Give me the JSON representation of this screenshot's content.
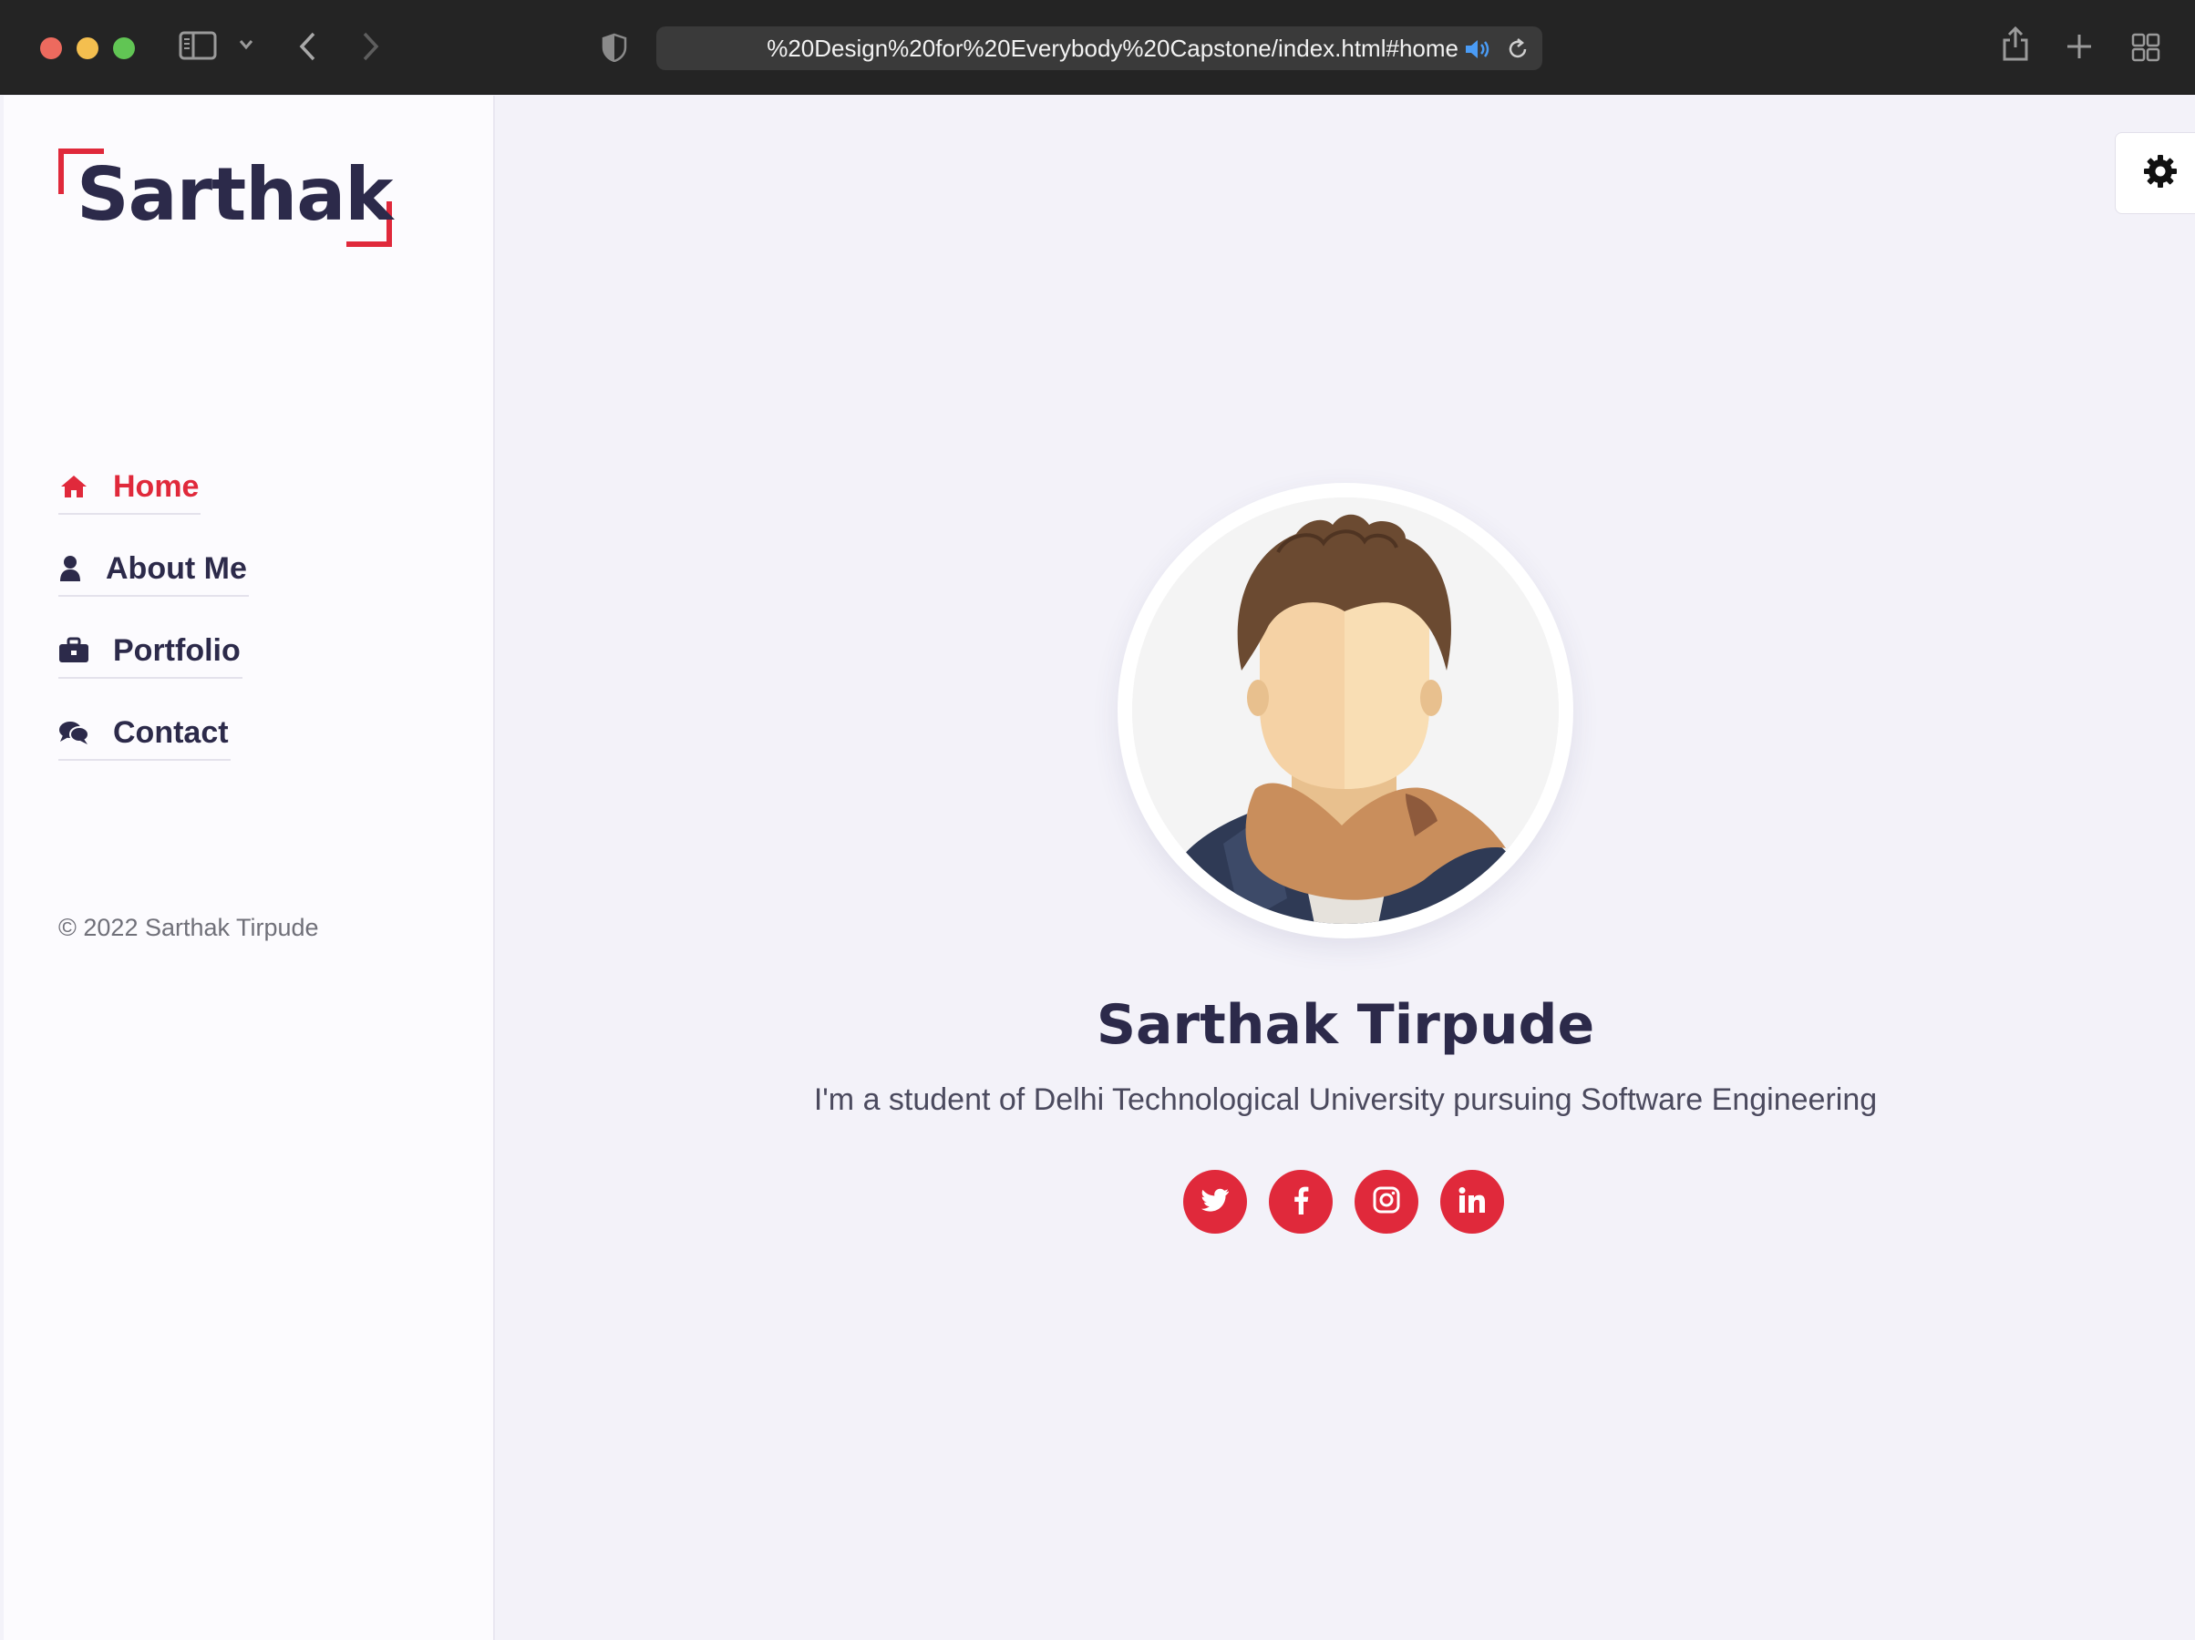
{
  "browser": {
    "url": "%20Design%20for%20Everybody%20Capstone/index.html#home",
    "icons": [
      "sidebar-toggle-icon",
      "chevron-down-icon",
      "back-icon",
      "forward-icon",
      "shield-icon",
      "speaker-icon",
      "reload-icon",
      "share-icon",
      "plus-icon",
      "tab-grid-icon"
    ]
  },
  "sidebar": {
    "logo": "Sarthak",
    "nav": [
      {
        "label": "Home",
        "icon": "home-icon",
        "active": true
      },
      {
        "label": "About Me",
        "icon": "user-icon",
        "active": false
      },
      {
        "label": "Portfolio",
        "icon": "briefcase-icon",
        "active": false
      },
      {
        "label": "Contact",
        "icon": "chat-icon",
        "active": false
      }
    ],
    "copyright": "© 2022 Sarthak Tirpude"
  },
  "main": {
    "name": "Sarthak Tirpude",
    "bio": "I'm a student of Delhi Technological University pursuing Software Engineering",
    "socials": [
      "twitter-icon",
      "facebook-icon",
      "instagram-icon",
      "linkedin-icon"
    ]
  },
  "colors": {
    "accent": "#e0293b",
    "text_dark": "#2c2a4a",
    "background": "#f3f2f9",
    "sidebar_bg": "#fcfbfe"
  }
}
